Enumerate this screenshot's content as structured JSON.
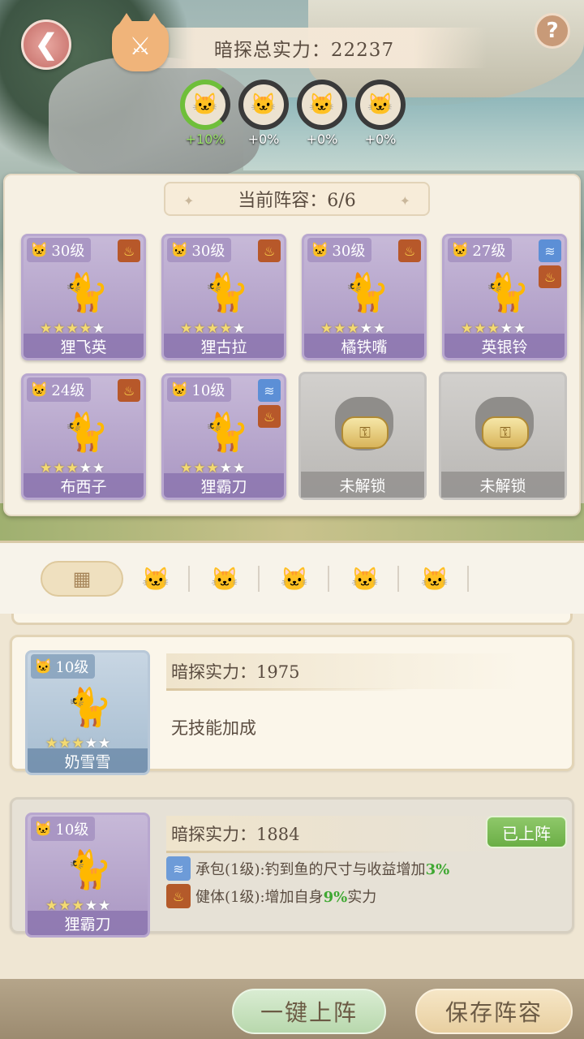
{
  "header": {
    "back_icon": "arrow-left",
    "total_label": "暗探总实力：22237",
    "help_label": "?"
  },
  "bonuses": [
    {
      "cat": "gray-cat",
      "value": "+10%",
      "active": true
    },
    {
      "cat": "orange-cat",
      "value": "+0%",
      "active": false
    },
    {
      "cat": "white-cat",
      "value": "+0%",
      "active": false
    },
    {
      "cat": "blue-cat",
      "value": "+0%",
      "active": false
    }
  ],
  "lineup": {
    "title": "当前阵容：6/6",
    "cards": [
      {
        "level": "30级",
        "name": "狸飞英",
        "stars": 5,
        "filled": 4,
        "skills": [
          "fire"
        ]
      },
      {
        "level": "30级",
        "name": "狸古拉",
        "stars": 5,
        "filled": 4,
        "skills": [
          "fire"
        ]
      },
      {
        "level": "30级",
        "name": "橘铁嘴",
        "stars": 5,
        "filled": 3,
        "skills": [
          "fire"
        ]
      },
      {
        "level": "27级",
        "name": "英银铃",
        "stars": 5,
        "filled": 3,
        "skills": [
          "blue",
          "fire"
        ]
      },
      {
        "level": "24级",
        "name": "布西子",
        "stars": 5,
        "filled": 3,
        "skills": [
          "fire"
        ]
      },
      {
        "level": "10级",
        "name": "狸霸刀",
        "stars": 5,
        "filled": 3,
        "skills": [
          "blue",
          "fire"
        ]
      }
    ],
    "locked_label_1": "未解锁",
    "locked_label_2": "未解锁"
  },
  "filters": [
    "all",
    "gray-cat",
    "orange-cat",
    "white-gray-cat",
    "blue-cat",
    "calico-cat"
  ],
  "list": [
    {
      "level": "10级",
      "name": "奶雪雪",
      "power": "暗探实力：1975",
      "no_skill": "无技能加成"
    },
    {
      "level": "10级",
      "name": "狸霸刀",
      "power": "暗探实力：1884",
      "status": "已上阵",
      "skill1_prefix": "承包(1级):钓到鱼的尺寸与收益增加",
      "skill1_value": "3%",
      "skill2_prefix": "健体(1级):增加自身",
      "skill2_value": "9%",
      "skill2_suffix": "实力"
    }
  ],
  "buttons": {
    "quick_deploy": "一键上阵",
    "save_lineup": "保存阵容"
  },
  "colors": {
    "accent_green": "#6aae46",
    "card_purple": "#a996c2",
    "bonus_ring_active": "#6fbf3a"
  }
}
